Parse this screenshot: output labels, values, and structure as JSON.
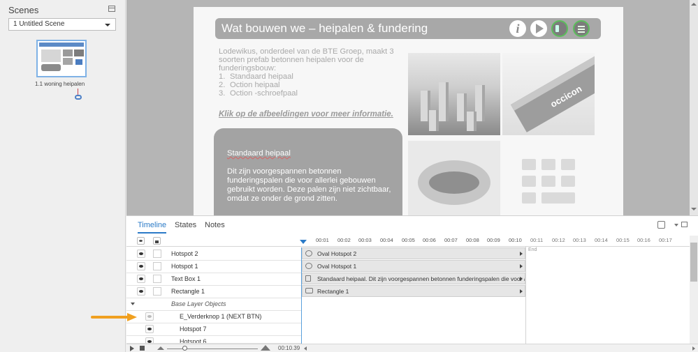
{
  "scenes_panel": {
    "title": "Scenes",
    "scene_select": "1 Untitled Scene",
    "slide_label": "1.1 woning heipalen"
  },
  "slide": {
    "title": "Wat bouwen we – heipalen & fundering",
    "info_icon": "i",
    "intro": "Lodewikus, onderdeel van de BTE Groep, maakt 3 soorten prefab betonnen heipalen voor de funderingsbouw:",
    "list": [
      {
        "num": "1.",
        "text": "Standaard heipaal"
      },
      {
        "num": "2.",
        "text": "Oction heipaal"
      },
      {
        "num": "3.",
        "text": "Oction -schroefpaal"
      }
    ],
    "hint": "Klik op de afbeeldingen voor meer informatie.",
    "info_heading": "Standaard heipaal",
    "info_body": "Dit zijn voorgespannen betonnen funderingspalen die voor allerlei gebouwen gebruikt worden. Deze palen zijn niet zichtbaar, omdat ze onder de grond zitten.",
    "photo_brand": "occicon",
    "icons": [
      "info-icon",
      "play-icon",
      "audio-icon",
      "menu-icon",
      "grid-icon"
    ]
  },
  "timeline": {
    "tabs": [
      "Timeline",
      "States",
      "Notes"
    ],
    "ticks": [
      "00:01",
      "00:02",
      "00:03",
      "00:04",
      "00:05",
      "00:06",
      "00:07",
      "00:08",
      "00:09",
      "00:10",
      "00:11",
      "00:12",
      "00:13",
      "00:14",
      "00:15",
      "00:16",
      "00:17"
    ],
    "end_label": "End",
    "layers": [
      {
        "name": "Hotspot 2"
      },
      {
        "name": "Hotspot 1"
      },
      {
        "name": "Text Box 1"
      },
      {
        "name": "Rectangle 1"
      }
    ],
    "group_label": "Base Layer Objects",
    "base_objects": [
      {
        "name": "E_Verderknop 1 (NEXT BTN)"
      },
      {
        "name": "Hotspot 7"
      },
      {
        "name": "Hotspot 6"
      }
    ],
    "bars": [
      {
        "label": "Oval Hotspot 2",
        "icon": "oval-icon"
      },
      {
        "label": "Oval Hotspot 1",
        "icon": "oval-icon"
      },
      {
        "label": "Standaard heipaal. Dit zijn voorgespannen betonnen funderingspalen die voor aller...",
        "icon": "text-box-icon"
      },
      {
        "label": "Rectangle 1",
        "icon": "rectangle-icon"
      }
    ],
    "time": "00:10.39"
  },
  "colors": {
    "accent": "#2a7ac7",
    "annotation": "#f0a020",
    "slide_title_bar": "#a8a8a8",
    "info_box": "#a3a3a3",
    "green_ring": "#5bbf5b"
  }
}
